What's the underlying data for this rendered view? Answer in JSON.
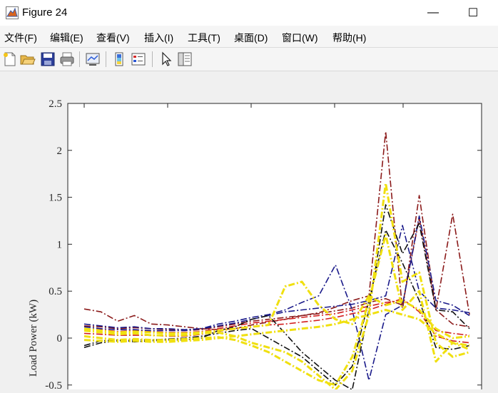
{
  "window": {
    "title": "Figure 24",
    "minimize_glyph": "—",
    "maximize_glyph": "☐"
  },
  "menu": [
    {
      "label": "文件(F)"
    },
    {
      "label": "编辑(E)"
    },
    {
      "label": "查看(V)"
    },
    {
      "label": "插入(I)"
    },
    {
      "label": "工具(T)"
    },
    {
      "label": "桌面(D)"
    },
    {
      "label": "窗口(W)"
    },
    {
      "label": "帮助(H)"
    }
  ],
  "toolbar": {
    "icons": [
      "new-figure-icon",
      "open-file-icon",
      "save-icon",
      "print-icon",
      "link-plot-icon",
      "colorbar-icon",
      "legend-icon",
      "edit-plot-arrow-icon",
      "property-inspector-icon"
    ]
  },
  "chart_data": {
    "type": "line",
    "title": "",
    "xlabel": "",
    "ylabel": "Load Power (kW)",
    "ylim": [
      -0.5,
      2.5
    ],
    "xlim": [
      1,
      24
    ],
    "yticks": [
      "2.5",
      "2",
      "1.5",
      "1",
      "0.5",
      "0",
      "-0.5"
    ],
    "x": [
      1,
      2,
      3,
      4,
      5,
      6,
      7,
      8,
      9,
      10,
      11,
      12,
      13,
      14,
      15,
      16,
      17,
      18,
      19,
      20,
      21,
      22,
      23,
      24
    ],
    "grid": false,
    "line_style": "dash-dot",
    "colors": {
      "yellow": "#f0e010",
      "dark_red": "#8b1a1a",
      "red": "#d21e1e",
      "dark_blue": "#1a1a8a",
      "black": "#111111"
    },
    "series": [
      {
        "color": "dark_red",
        "values": [
          0.31,
          0.28,
          0.18,
          0.24,
          0.15,
          0.14,
          0.12,
          0.1,
          0.09,
          0.1,
          0.14,
          0.17,
          0.2,
          0.24,
          0.27,
          0.33,
          0.4,
          0.45,
          2.2,
          0.3,
          1.52,
          0.3,
          1.32,
          0.25
        ]
      },
      {
        "color": "dark_red",
        "values": [
          0.13,
          0.12,
          0.1,
          0.11,
          0.1,
          0.09,
          0.08,
          0.09,
          0.12,
          0.15,
          0.18,
          0.2,
          0.22,
          0.24,
          0.26,
          0.29,
          0.32,
          0.38,
          0.42,
          0.35,
          1.28,
          0.3,
          0.15,
          0.12
        ]
      },
      {
        "color": "red",
        "values": [
          0.1,
          0.09,
          0.07,
          0.08,
          0.07,
          0.06,
          0.06,
          0.07,
          0.1,
          0.13,
          0.16,
          0.18,
          0.2,
          0.22,
          0.24,
          0.26,
          0.3,
          0.34,
          0.38,
          0.4,
          0.3,
          0.08,
          0.05,
          0.03
        ]
      },
      {
        "color": "red",
        "values": [
          0.05,
          0.04,
          0.03,
          0.03,
          0.03,
          0.02,
          0.02,
          0.04,
          0.07,
          0.1,
          0.12,
          0.14,
          0.15,
          0.17,
          0.19,
          0.22,
          0.26,
          0.3,
          0.36,
          0.42,
          0.28,
          0.02,
          -0.03,
          -0.05
        ]
      },
      {
        "color": "dark_blue",
        "values": [
          0.15,
          0.13,
          0.11,
          0.12,
          0.1,
          0.1,
          0.09,
          0.1,
          0.15,
          0.18,
          0.22,
          0.25,
          0.3,
          0.38,
          0.45,
          0.78,
          0.3,
          -0.45,
          0.25,
          0.35,
          1.3,
          0.4,
          0.35,
          0.24
        ]
      },
      {
        "color": "dark_blue",
        "values": [
          0.12,
          0.1,
          0.09,
          0.09,
          0.08,
          0.08,
          0.08,
          0.1,
          0.13,
          0.16,
          0.2,
          0.24,
          0.28,
          0.3,
          0.32,
          0.34,
          0.36,
          0.4,
          0.45,
          1.2,
          0.5,
          0.32,
          0.3,
          0.27
        ]
      },
      {
        "color": "black",
        "values": [
          -0.08,
          -0.03,
          -0.02,
          -0.04,
          -0.03,
          -0.02,
          -0.02,
          0.0,
          0.08,
          0.12,
          0.2,
          0.24,
          0.05,
          -0.15,
          -0.3,
          -0.45,
          -0.55,
          0.3,
          1.42,
          0.9,
          1.22,
          0.3,
          0.28,
          0.1
        ]
      },
      {
        "color": "black",
        "values": [
          -0.1,
          -0.05,
          -0.03,
          -0.02,
          -0.02,
          -0.01,
          0.0,
          0.02,
          0.05,
          0.08,
          0.1,
          0.0,
          -0.1,
          -0.2,
          -0.35,
          -0.5,
          -0.3,
          0.4,
          1.15,
          0.8,
          0.4,
          -0.1,
          -0.12,
          -0.08
        ]
      },
      {
        "color": "yellow",
        "values": [
          0.08,
          0.06,
          0.04,
          0.05,
          0.03,
          0.03,
          0.03,
          0.05,
          0.06,
          0.02,
          -0.05,
          -0.1,
          -0.15,
          -0.25,
          -0.4,
          -0.55,
          -0.35,
          0.25,
          1.65,
          0.6,
          0.7,
          -0.05,
          -0.2,
          -0.15
        ]
      },
      {
        "color": "yellow",
        "values": [
          0.02,
          0.0,
          -0.02,
          -0.01,
          -0.02,
          -0.02,
          -0.01,
          0.0,
          0.01,
          -0.02,
          -0.08,
          -0.15,
          -0.25,
          -0.35,
          -0.45,
          -0.5,
          -0.2,
          0.4,
          1.1,
          0.3,
          0.5,
          -0.25,
          -0.05,
          -0.12
        ]
      },
      {
        "color": "yellow",
        "values": [
          0.1,
          0.08,
          0.06,
          0.07,
          0.06,
          0.05,
          0.05,
          0.06,
          0.08,
          0.1,
          0.12,
          0.14,
          0.55,
          0.6,
          0.35,
          0.2,
          0.15,
          0.45,
          0.35,
          0.4,
          0.3,
          0.1,
          0.0,
          0.02
        ]
      },
      {
        "color": "yellow",
        "values": [
          -0.02,
          -0.03,
          -0.04,
          -0.03,
          -0.04,
          -0.04,
          -0.03,
          -0.02,
          0.0,
          0.02,
          0.04,
          0.06,
          0.08,
          0.1,
          0.12,
          0.15,
          0.2,
          0.25,
          0.3,
          0.25,
          0.2,
          0.05,
          -0.05,
          -0.08
        ]
      }
    ]
  }
}
